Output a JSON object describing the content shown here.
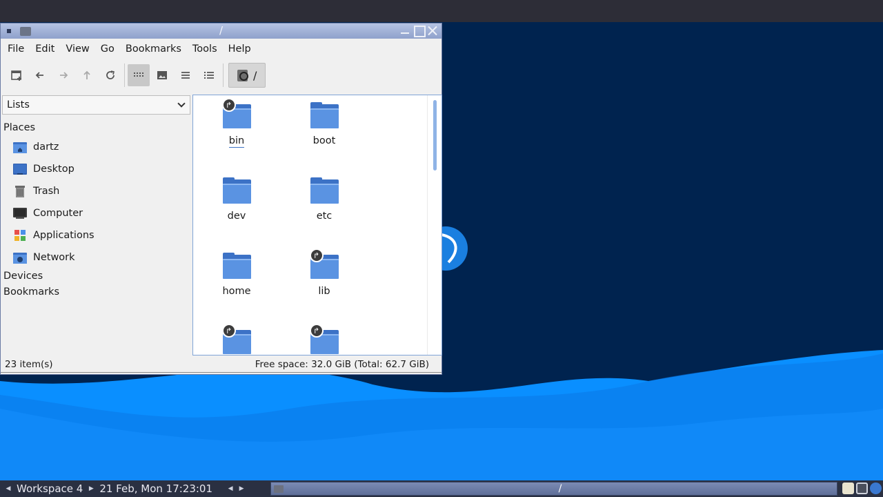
{
  "window": {
    "title": "/",
    "menu": [
      "File",
      "Edit",
      "View",
      "Go",
      "Bookmarks",
      "Tools",
      "Help"
    ],
    "path_label": "/"
  },
  "sidebar": {
    "selector": "Lists",
    "places_header": "Places",
    "places": [
      {
        "label": "dartz",
        "icon": "home-folder-icon"
      },
      {
        "label": "Desktop",
        "icon": "desktop-icon"
      },
      {
        "label": "Trash",
        "icon": "trash-icon"
      },
      {
        "label": "Computer",
        "icon": "computer-icon"
      },
      {
        "label": "Applications",
        "icon": "applications-icon"
      },
      {
        "label": "Network",
        "icon": "network-icon"
      }
    ],
    "devices_header": "Devices",
    "bookmarks_header": "Bookmarks"
  },
  "files": [
    {
      "name": "bin",
      "link": true,
      "current": true
    },
    {
      "name": "boot",
      "link": false
    },
    {
      "name": "dev",
      "link": false
    },
    {
      "name": "etc",
      "link": false
    },
    {
      "name": "home",
      "link": false
    },
    {
      "name": "lib",
      "link": true
    },
    {
      "name": "",
      "link": true
    },
    {
      "name": "",
      "link": true
    }
  ],
  "status": {
    "count": "23 item(s)",
    "space": "Free space: 32.0 GiB (Total: 62.7 GiB)"
  },
  "taskbar": {
    "workspace": "Workspace 4",
    "clock": "21 Feb, Mon 17:23:01",
    "task_title": "/"
  },
  "colors": {
    "folder": "#5a93e2",
    "desktop_wave": "#0a8fff",
    "selection": "#c8c8c8"
  }
}
